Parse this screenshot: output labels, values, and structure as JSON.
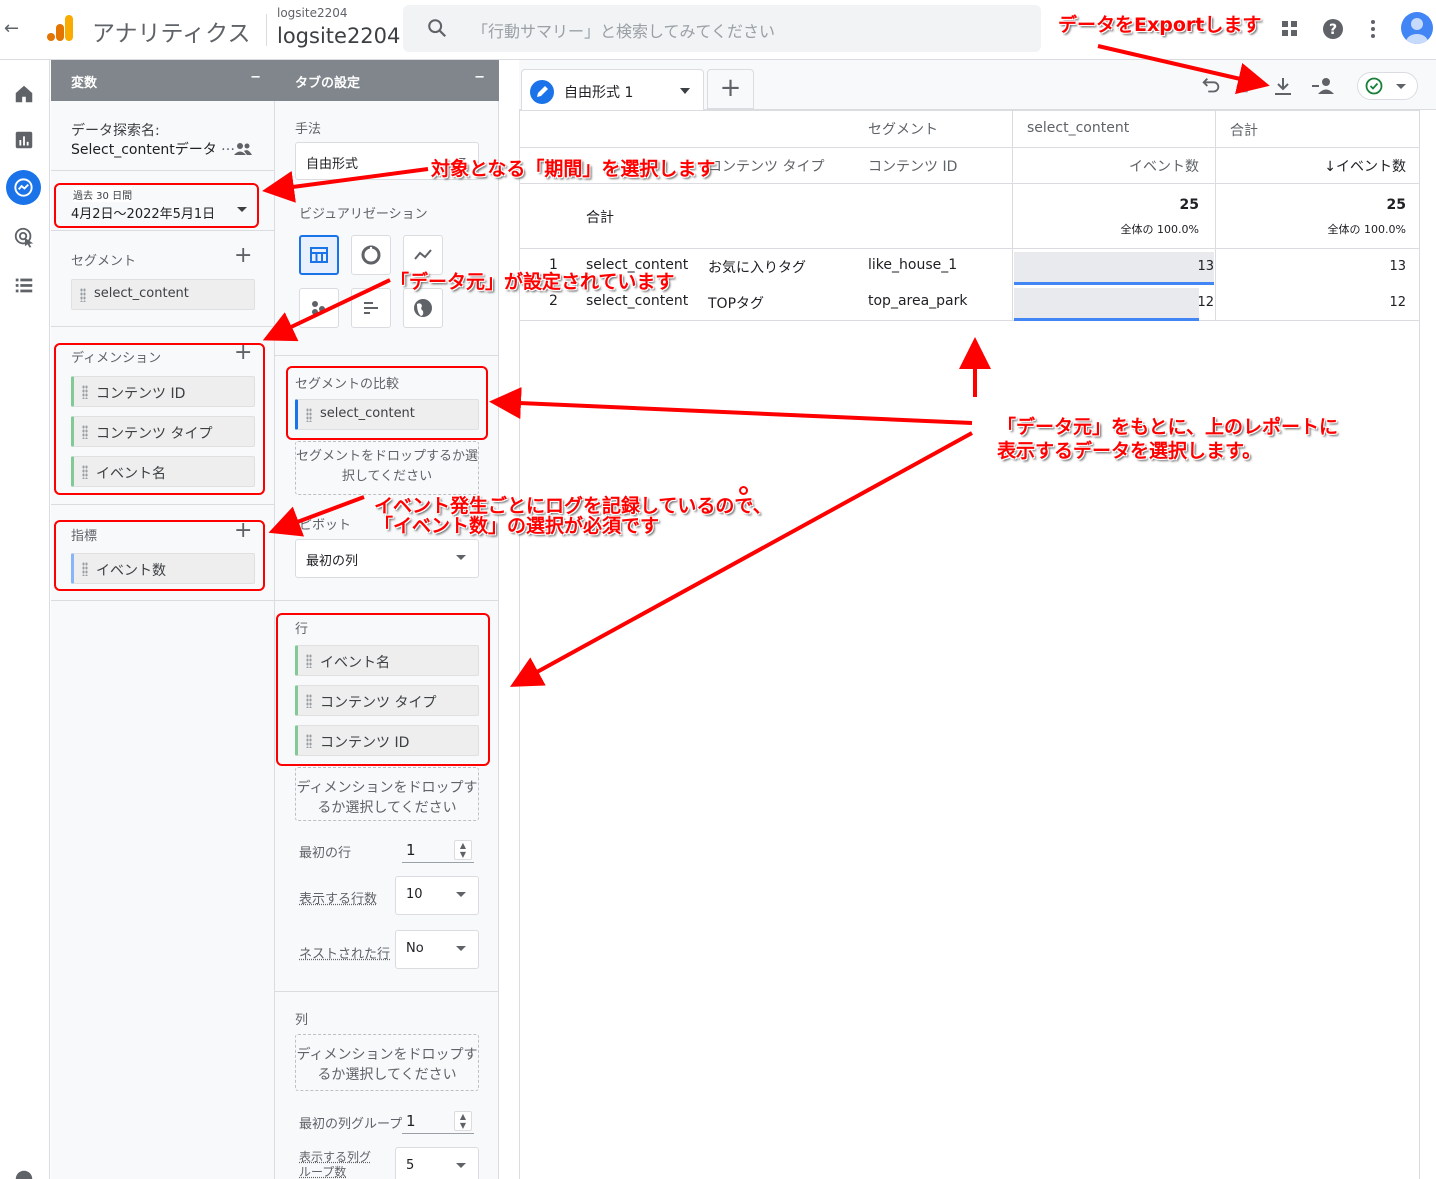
{
  "header": {
    "back_icon": "arrow-left-icon",
    "app_name": "アナリティクス",
    "account_small": "logsite2204",
    "account_big": "logsite2204",
    "search_placeholder": "「行動サマリー」と検索してみてください",
    "brand_colors": [
      "#f9ab00",
      "#e37400"
    ]
  },
  "variables_panel": {
    "title": "変数",
    "minimize": "−",
    "exploration_label": "データ探索名:",
    "exploration_name": "Select_contentデータ",
    "more": "…",
    "date_small": "過去 30 日間",
    "date_range": "4月2日～2022年5月1日",
    "segments_label": "セグメント",
    "segments": [
      "select_content"
    ],
    "dimensions_label": "ディメンション",
    "dimensions": [
      "コンテンツ ID",
      "コンテンツ タイプ",
      "イベント名"
    ],
    "metrics_label": "指標",
    "metrics": [
      "イベント数"
    ],
    "add": "+"
  },
  "tab_settings": {
    "title": "タブの設定",
    "minimize": "−",
    "technique_label": "手法",
    "technique_value": "自由形式",
    "visualization_label": "ビジュアリゼーション",
    "segment_compare_label": "セグメントの比較",
    "segment_compare": [
      "select_content"
    ],
    "segment_drop": "セグメントをドロップするか選択してください",
    "pivot_label": "ピボット",
    "pivot_value": "最初の列",
    "rows_label": "行",
    "rows": [
      "イベント名",
      "コンテンツ タイプ",
      "コンテンツ ID"
    ],
    "dimension_drop": "ディメンションをドロップするか選択してください",
    "first_row_label": "最初の行",
    "first_row_value": "1",
    "rows_shown_label": "表示する行数",
    "rows_shown_value": "10",
    "nested_rows_label": "ネストされた行",
    "nested_rows_value": "No",
    "columns_label": "列",
    "column_drop": "ディメンションをドロップするか選択してください",
    "first_col_group_label": "最初の列グループ",
    "first_col_group_value": "1",
    "col_groups_shown_label": "表示する列グループ数",
    "col_groups_shown_value": "5"
  },
  "report": {
    "tab_name": "自由形式 1",
    "add_tab": "+",
    "status_color": "#188038",
    "header_segment": "セグメント",
    "header_col1": "select_content",
    "header_col2": "合計",
    "dim_headers": [
      "",
      "コンテンツ タイプ",
      "コンテンツ ID"
    ],
    "metric_header": "イベント数",
    "metric_header_sorted": "↓イベント数",
    "total_label": "合計",
    "total_value1": "25",
    "total_pct1": "全体の 100.0%",
    "total_value2": "25",
    "total_pct2": "全体の 100.0%",
    "rows": [
      {
        "idx": "1",
        "event": "select_content",
        "type": "お気に入りタグ",
        "id": "like_house_1",
        "v1": "13",
        "v2": "13",
        "share": 1.0
      },
      {
        "idx": "2",
        "event": "select_content",
        "type": "TOPタグ",
        "id": "top_area_park",
        "v1": "12",
        "v2": "12",
        "share": 0.923
      }
    ]
  },
  "annotations": {
    "export": "データをExportします",
    "period": "対象となる「期間」を選択します",
    "data_source": "「データ元」が設定されています",
    "select_line1": "「データ元」をもとに、上のレポートに",
    "select_line2": "表示するデータを選択します。",
    "event_line1": "イベント発生ごとにログを記録しているので、",
    "event_line2": "「イベント数」の選択が必須です",
    "color": "#ff0000"
  }
}
